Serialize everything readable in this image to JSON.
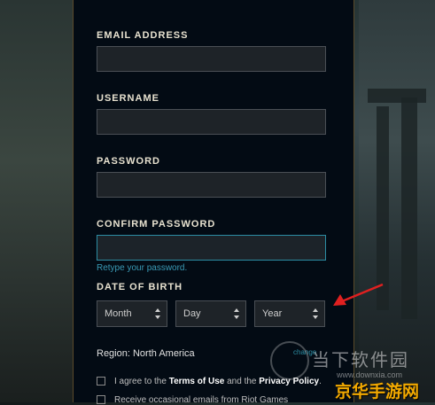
{
  "form": {
    "email_label": "EMAIL ADDRESS",
    "email_value": "",
    "username_label": "USERNAME",
    "username_value": "",
    "password_label": "PASSWORD",
    "password_value": "",
    "confirm_label": "CONFIRM PASSWORD",
    "confirm_value": "",
    "confirm_hint": "Retype your password.",
    "dob_label": "DATE OF BIRTH",
    "month": "Month",
    "day": "Day",
    "year": "Year",
    "region_text": "Region: North America",
    "change_link": "change",
    "terms": {
      "prefix": "I agree to the ",
      "terms_link": "Terms of Use",
      "middle": " and the ",
      "privacy_link": "Privacy Policy",
      "suffix": "."
    },
    "emails_text": "Receive occasional emails from Riot Games"
  },
  "watermark": {
    "title": "当下软件园",
    "url": "www.downxia.com",
    "brand": "京华手游网"
  },
  "colors": {
    "panel_bg": "#030b14",
    "accent_teal": "#2c8da3",
    "annotation_arrow": "#e02020",
    "brand_orange": "#f2a900"
  }
}
